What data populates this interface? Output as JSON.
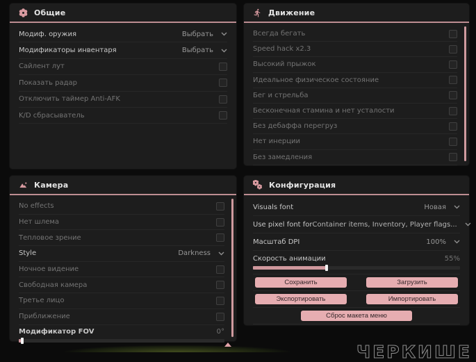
{
  "accent_color": "#d89aa0",
  "panels": {
    "general": {
      "title": "Общие",
      "rows": [
        {
          "label": "Модиф. оружия",
          "value": "Выбрать"
        },
        {
          "label": "Модификаторы инвентаря",
          "value": "Выбрать"
        },
        {
          "label": "Сайлент лут"
        },
        {
          "label": "Показать радар"
        },
        {
          "label": "Отключить таймер Anti-AFK"
        },
        {
          "label": "K/D сбрасыватель"
        }
      ]
    },
    "movement": {
      "title": "Движение",
      "rows": [
        {
          "label": "Всегда бегать"
        },
        {
          "label": "Speed hack x2.3"
        },
        {
          "label": "Высокий прыжок"
        },
        {
          "label": "Идеальное физическое состояние"
        },
        {
          "label": "Бег и стрельба"
        },
        {
          "label": "Бесконечная стамина и нет усталости"
        },
        {
          "label": "Без дебаффа перегруз"
        },
        {
          "label": "Нет инерции"
        },
        {
          "label": "Без замедления"
        }
      ]
    },
    "camera": {
      "title": "Камера",
      "rows": [
        {
          "label": "No effects"
        },
        {
          "label": "Нет шлема"
        },
        {
          "label": "Тепловое зрение"
        },
        {
          "label": "Style",
          "value": "Darkness"
        },
        {
          "label": "Ночное видение"
        },
        {
          "label": "Свободная камера"
        },
        {
          "label": "Третье лицо"
        },
        {
          "label": "Приближение"
        },
        {
          "label": "Модификатор FOV",
          "value": "0°",
          "slider_percent": 0
        }
      ]
    },
    "config": {
      "title": "Конфигурация",
      "rows": [
        {
          "label": "Visuals font",
          "value": "Новая"
        },
        {
          "label": "Use pixel font for",
          "value": "Container items, Inventory, Player flags..."
        },
        {
          "label": "Масштаб DPI",
          "value": "100%"
        },
        {
          "label": "Скорость анимации",
          "value": "55%",
          "slider_percent": 55
        }
      ],
      "buttons": {
        "save": "Сохранить",
        "load": "Загрузить",
        "export": "Экспортировать",
        "import": "Импортировать",
        "reset_layout": "Сброс макета меню"
      }
    }
  },
  "watermark": "ЧЕРКИШЕ"
}
